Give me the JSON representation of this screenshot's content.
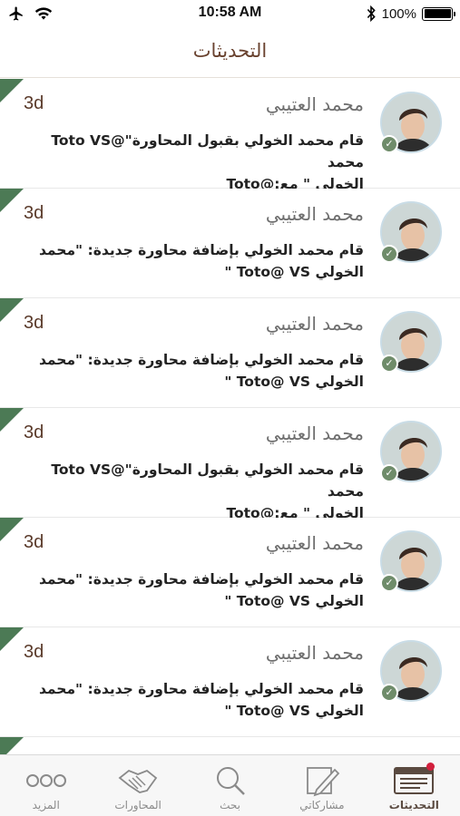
{
  "status_bar": {
    "time": "10:58 AM",
    "battery_percent": "100%",
    "battery_level": 1.0
  },
  "header": {
    "title": "التحديثات"
  },
  "feed": {
    "items": [
      {
        "age": "3d",
        "name": "محمد العتيبي",
        "line1": "قام محمد الخولي بقبول المحاورة\"@Toto VS محمد",
        "line2": "الخولي \" مع:@Toto"
      },
      {
        "age": "3d",
        "name": "محمد العتيبي",
        "line1": "قام محمد الخولي بإضافة محاورة جديدة: \"محمد",
        "line2": "الخولي Toto@ VS \""
      },
      {
        "age": "3d",
        "name": "محمد العتيبي",
        "line1": "قام محمد الخولي بإضافة محاورة جديدة: \"محمد",
        "line2": "الخولي Toto@ VS \""
      },
      {
        "age": "3d",
        "name": "محمد العتيبي",
        "line1": "قام محمد الخولي بقبول المحاورة\"@Toto VS محمد",
        "line2": "الخولي \" مع:@Toto"
      },
      {
        "age": "3d",
        "name": "محمد العتيبي",
        "line1": "قام محمد الخولي بإضافة محاورة جديدة: \"محمد",
        "line2": "الخولي Toto@ VS \""
      },
      {
        "age": "3d",
        "name": "محمد العتيبي",
        "line1": "قام محمد الخولي بإضافة محاورة جديدة: \"محمد",
        "line2": "الخولي Toto@ VS \""
      }
    ]
  },
  "tabbar": {
    "tabs": [
      {
        "label": "المزيد",
        "icon": "more-icon"
      },
      {
        "label": "المحاورات",
        "icon": "handshake-icon"
      },
      {
        "label": "بحث",
        "icon": "search-icon"
      },
      {
        "label": "مشاركاتي",
        "icon": "pen-icon"
      },
      {
        "label": "التحديثات",
        "icon": "updates-icon",
        "active": true
      }
    ]
  },
  "colors": {
    "accent_green": "#4c7a55",
    "title_brown": "#6a4330",
    "badge_red": "#d21f3c"
  }
}
